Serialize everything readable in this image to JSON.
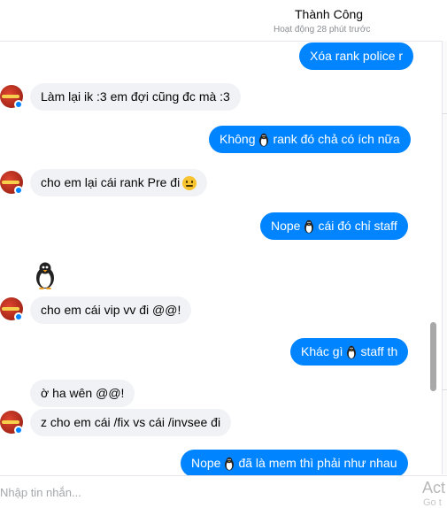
{
  "header": {
    "name": "Thành Công",
    "status": "Hoạt động 28 phút trước"
  },
  "messages": {
    "m1": {
      "text": "Xóa rank police r"
    },
    "m2": {
      "text": "Làm lại ik :3 em đợi cũng đc mà :3"
    },
    "m3": {
      "before": "Không",
      "after": "rank đó chả có ích nữa"
    },
    "m4": {
      "text": "cho em lại cái rank Pre đi"
    },
    "m5": {
      "before": "Nope",
      "after": "cái đó chỉ staff"
    },
    "m6": {
      "text": "cho em cái vip vv đi @@!"
    },
    "m7": {
      "before": "Khác gì",
      "after": "staff th"
    },
    "m8": {
      "text": "ờ ha wên @@!"
    },
    "m9": {
      "text": "z cho em cái /fix vs cái /invsee đi"
    },
    "m10": {
      "before": "Nope",
      "after": "đã là mem thì phải như nhau"
    }
  },
  "icons": {
    "penguin": "penguin-icon",
    "neutral_face": "neutral-face-icon",
    "avatar_badge": "messenger-badge-icon"
  },
  "composer": {
    "placeholder": "Nhập tin nhắn..."
  },
  "watermark": {
    "line1": "Act",
    "line2": "Go t"
  },
  "colors": {
    "outgoing": "#0084ff",
    "incoming": "#f0f2f5"
  }
}
